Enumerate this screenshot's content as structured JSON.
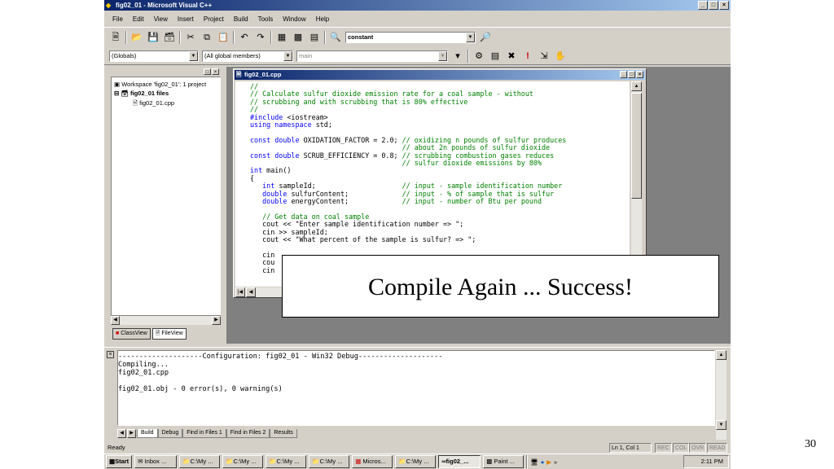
{
  "window": {
    "title": "fig02_01 - Microsoft Visual C++",
    "minimize": "_",
    "maximize": "□",
    "close": "×"
  },
  "menu": [
    "File",
    "Edit",
    "View",
    "Insert",
    "Project",
    "Build",
    "Tools",
    "Window",
    "Help"
  ],
  "toolbar": {
    "find_combo": "constant"
  },
  "wizardbar": {
    "class_combo": "(Globals)",
    "filter_combo": "(All global members)",
    "member_combo": "main"
  },
  "workspace": {
    "root": "Workspace 'fig02_01': 1 project",
    "project": "fig02_01 files",
    "file": "fig02_01.cpp",
    "tabs": [
      "ClassView",
      "FileView"
    ]
  },
  "editor": {
    "title": "fig02_01.cpp",
    "code_lines": [
      "//",
      "// Calculate sulfur dioxide emission rate for a coal sample - without",
      "// scrubbing and with scrubbing that is 80% effective",
      "//",
      "#include <iostream>",
      "using namespace std;",
      "",
      "const double OXIDATION_FACTOR = 2.0; // oxidizing n pounds of sulfur produces",
      "                                     // about 2n pounds of sulfur dioxide",
      "const double SCRUB_EFFICIENCY = 0.8; // scrubbing combustion gases reduces",
      "                                     // sulfur dioxide emissions by 80%",
      "int main()",
      "{",
      "   int sampleId;                     // input - sample identification number",
      "   double sulfurContent;             // input - % of sample that is sulfur",
      "   double energyContent;             // input - number of Btu per pound",
      "",
      "   // Get data on coal sample",
      "   cout << \"Enter sample identification number => \";",
      "   cin >> sampleId;",
      "   cout << \"What percent of the sample is sulfur? => \";",
      "",
      "   cin",
      "   cou",
      "   cin"
    ]
  },
  "overlay": {
    "message": "Compile Again ... Success!"
  },
  "output": {
    "lines": [
      "--------------------Configuration: fig02_01 - Win32 Debug--------------------",
      "Compiling...",
      "fig02_01.cpp",
      "",
      "fig02_01.obj - 0 error(s), 0 warning(s)"
    ],
    "tabs": [
      "Build",
      "Debug",
      "Find in Files 1",
      "Find in Files 2",
      "Results"
    ]
  },
  "status": {
    "ready": "Ready",
    "position": "Ln 1, Col 1",
    "indicators": [
      "REC",
      "COL",
      "OVR",
      "READ"
    ]
  },
  "taskbar": {
    "start": "Start",
    "buttons": [
      "Inbox ...",
      "C:\\My ...",
      "C:\\My ...",
      "C:\\My ...",
      "C:\\My ...",
      "Micros...",
      "C:\\My ...",
      "fig02_...",
      "Paint ..."
    ],
    "clock": "2:11 PM"
  },
  "slide": {
    "page_number": "30"
  }
}
